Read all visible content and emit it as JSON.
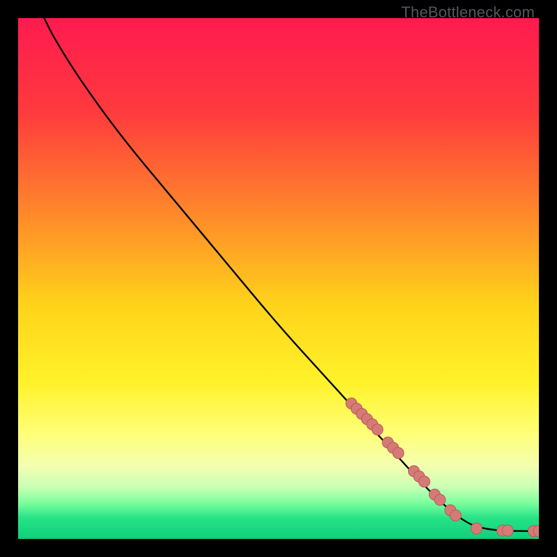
{
  "watermark": "TheBottleneck.com",
  "chart_data": {
    "type": "line",
    "title": "",
    "xlabel": "",
    "ylabel": "",
    "xlim": [
      0,
      100
    ],
    "ylim": [
      0,
      100
    ],
    "gradient_stops": [
      {
        "pct": 0,
        "color": "#ff1a4f"
      },
      {
        "pct": 18,
        "color": "#ff3a3d"
      },
      {
        "pct": 38,
        "color": "#ff8a2a"
      },
      {
        "pct": 55,
        "color": "#ffd31a"
      },
      {
        "pct": 70,
        "color": "#fff22a"
      },
      {
        "pct": 80,
        "color": "#ffff7a"
      },
      {
        "pct": 86,
        "color": "#f3ffb0"
      },
      {
        "pct": 90,
        "color": "#c9ffb5"
      },
      {
        "pct": 93,
        "color": "#7fff9e"
      },
      {
        "pct": 96,
        "color": "#27e387"
      },
      {
        "pct": 100,
        "color": "#0ecf7a"
      }
    ],
    "curve": [
      {
        "x": 5,
        "y": 100
      },
      {
        "x": 7,
        "y": 96
      },
      {
        "x": 12,
        "y": 88
      },
      {
        "x": 20,
        "y": 77
      },
      {
        "x": 30,
        "y": 65
      },
      {
        "x": 40,
        "y": 53
      },
      {
        "x": 50,
        "y": 41
      },
      {
        "x": 60,
        "y": 30
      },
      {
        "x": 70,
        "y": 19
      },
      {
        "x": 80,
        "y": 8
      },
      {
        "x": 86,
        "y": 3
      },
      {
        "x": 90,
        "y": 1.8
      },
      {
        "x": 95,
        "y": 1.5
      },
      {
        "x": 100,
        "y": 1.5
      }
    ],
    "markers": [
      {
        "x": 64,
        "y": 26
      },
      {
        "x": 65,
        "y": 25
      },
      {
        "x": 66,
        "y": 24
      },
      {
        "x": 67,
        "y": 23
      },
      {
        "x": 68,
        "y": 22
      },
      {
        "x": 69,
        "y": 21
      },
      {
        "x": 71,
        "y": 18.5
      },
      {
        "x": 72,
        "y": 17.5
      },
      {
        "x": 73,
        "y": 16.5
      },
      {
        "x": 76,
        "y": 13
      },
      {
        "x": 77,
        "y": 12
      },
      {
        "x": 78,
        "y": 11
      },
      {
        "x": 80,
        "y": 8.5
      },
      {
        "x": 81,
        "y": 7.5
      },
      {
        "x": 83,
        "y": 5.5
      },
      {
        "x": 84,
        "y": 4.5
      },
      {
        "x": 88,
        "y": 2
      },
      {
        "x": 93,
        "y": 1.6
      },
      {
        "x": 94,
        "y": 1.6
      },
      {
        "x": 99,
        "y": 1.5
      },
      {
        "x": 100,
        "y": 1.5
      }
    ],
    "marker_style": {
      "fill": "#d67a78",
      "stroke": "#b85a56",
      "radius_px": 8
    }
  }
}
